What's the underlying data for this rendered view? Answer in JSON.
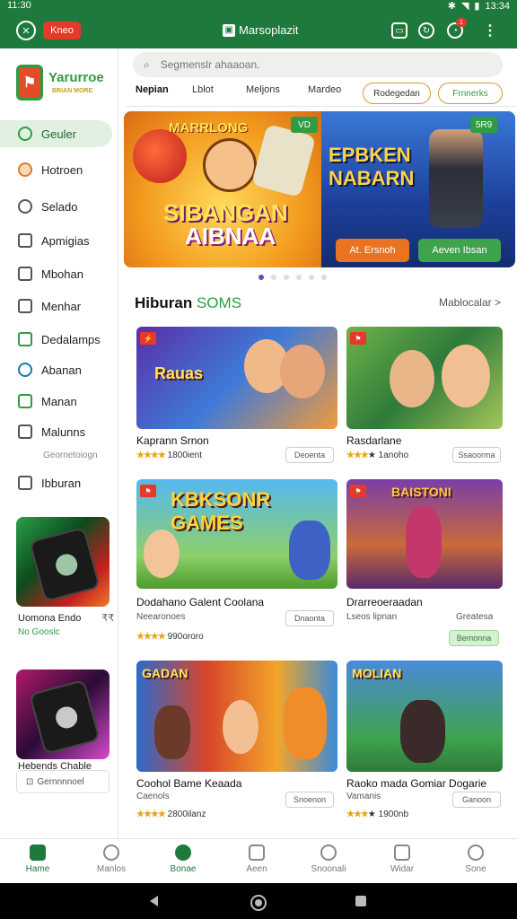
{
  "status": {
    "time": "11:30",
    "right": "13:34"
  },
  "appbar": {
    "button_label": "Kneo",
    "title": "Marsoplazit",
    "badge": "1"
  },
  "sidebar": {
    "logo_text": "Yarurroe",
    "logo_sub": "BRIAN MORE",
    "items": [
      {
        "label": "Geuler"
      },
      {
        "label": "Hotroen"
      },
      {
        "label": "Selado"
      },
      {
        "label": "Apmigias"
      },
      {
        "label": "Mbohan"
      },
      {
        "label": "Menhar"
      },
      {
        "label": "Dedalamps"
      },
      {
        "label": "Abanan"
      },
      {
        "label": "Manan"
      },
      {
        "label": "Malunns"
      },
      {
        "label": "Ibburan"
      }
    ],
    "sub_label": "Geornetoiogn",
    "ad1": {
      "title": "Uomona Endo",
      "extra": "₹₹",
      "sub": "No Gooslc"
    },
    "ad2": {
      "title": "Hebends Chable",
      "button": "Gernnnnoel"
    }
  },
  "search": {
    "placeholder": "Segmenslr ahaaoan."
  },
  "tabs": [
    {
      "label": "Nepian"
    },
    {
      "label": "Lblot"
    },
    {
      "label": "Meljons"
    },
    {
      "label": "Mardeo"
    }
  ],
  "pills": [
    {
      "label": "Rodegedan"
    },
    {
      "label": "Frnnerks"
    }
  ],
  "banner": {
    "title_top": "MARRLONG",
    "title_main": "SIBANGAN",
    "title_sub": "AIBNAA",
    "right_line1": "EPBKEN",
    "right_line2": "NABARN",
    "tag_left": "VD",
    "tag_right": "5R9",
    "btn1": "At. Ersnoh",
    "btn2": "Aeven Ibsan"
  },
  "section": {
    "title": "Hiburan",
    "accent": "SOMS",
    "more": "Mablocalar >"
  },
  "cards": [
    {
      "name": "Kaprann Srnon",
      "rating": "1800ient",
      "button": "Deoenta",
      "art": "Rauas"
    },
    {
      "name": "Rasdarlane",
      "rating": "1anoho",
      "button": "Ssaoorma",
      "art": ""
    },
    {
      "name": "Dodahano Galent Coolana",
      "sub": "Neearonoes",
      "rating": "990ororo",
      "button": "Dnaonta",
      "art": "KBKSONR GAMES"
    },
    {
      "name": "Drarreoeraadan",
      "sub": "Lseos lipnan",
      "rating": "Greatesa",
      "button": "Bemonna",
      "art": "BAISTONI"
    },
    {
      "name": "Coohol Bame Keaada",
      "sub": "Caenols",
      "rating": "2800ilanz",
      "button": "Snoenon",
      "art": "GADAN"
    },
    {
      "name": "Raoko mada Gomiar Dogarie",
      "sub": "Vamanis",
      "rating": "1900nb",
      "button": "Ganoon",
      "art": "MOLIAN"
    }
  ],
  "bottom_nav": [
    {
      "label": "Hame"
    },
    {
      "label": "Manlos"
    },
    {
      "label": "Bonae"
    },
    {
      "label": "Aeen"
    },
    {
      "label": "Snoonali"
    },
    {
      "label": "Widar"
    },
    {
      "label": "Sone"
    }
  ]
}
